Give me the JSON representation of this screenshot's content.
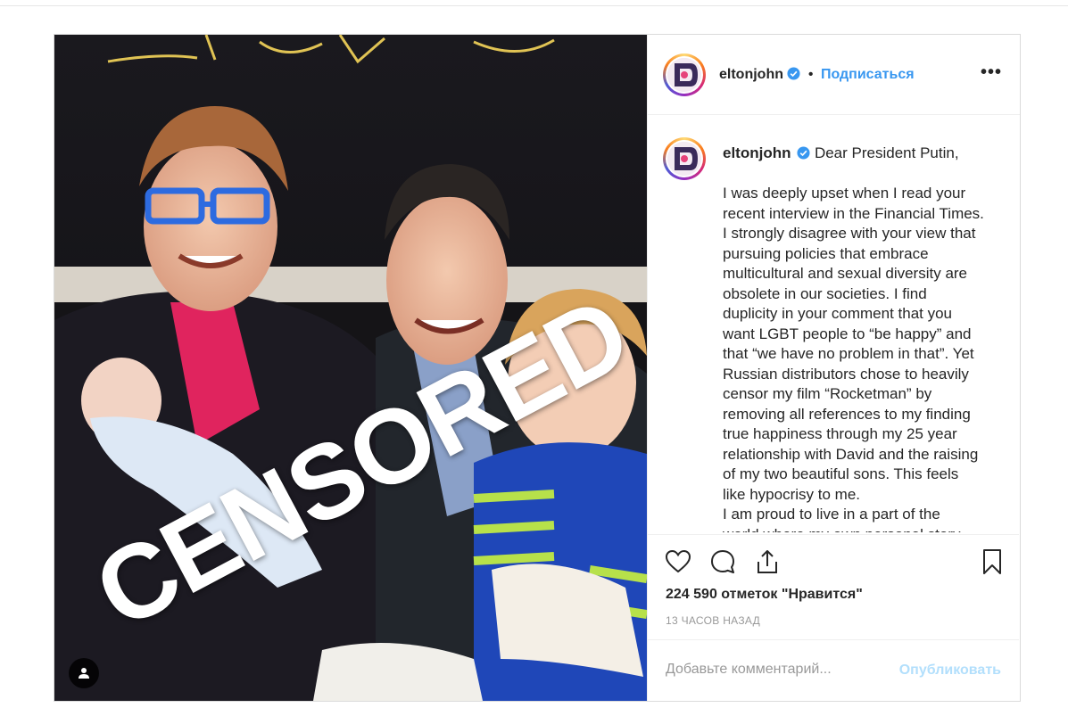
{
  "post": {
    "username": "eltonjohn",
    "follow_label": "Подписаться",
    "dot": "•",
    "more_label": "•••",
    "overlay_text": "CENSORED",
    "caption_lines": [
      "Dear President Putin,",
      "",
      "I was deeply upset when I read your",
      "recent interview in the Financial Times.",
      "I strongly disagree with your view that",
      "pursuing policies that embrace",
      "multicultural and sexual diversity are",
      "obsolete in our societies. I find",
      "duplicity in your comment that you",
      "want LGBT people to “be happy” and",
      "that “we have no problem in that”. Yet",
      "Russian distributors chose to heavily",
      "censor my film “Rocketman” by",
      "removing all references to my finding",
      "true happiness through my 25 year",
      "relationship with David and the raising",
      "of my two beautiful sons. This feels",
      "like hypocrisy to me.",
      "I am proud to live in a part of the",
      "world where my own personal story"
    ],
    "likes_text": "224 590 отметок \"Нравится\"",
    "time_text": "13 ЧАСОВ НАЗАД",
    "comment_placeholder": "Добавьте комментарий...",
    "publish_label": "Опубликовать"
  },
  "icons": {
    "verified": "verified-badge-icon",
    "like": "heart-icon",
    "comment": "comment-icon",
    "share": "share-icon",
    "save": "bookmark-icon",
    "user_tag": "user-icon",
    "more": "more-options-icon"
  },
  "colors": {
    "link_blue": "#3897f0",
    "publish_disabled": "#b2dffc",
    "muted_text": "#999999",
    "border": "#dbdbdb"
  }
}
